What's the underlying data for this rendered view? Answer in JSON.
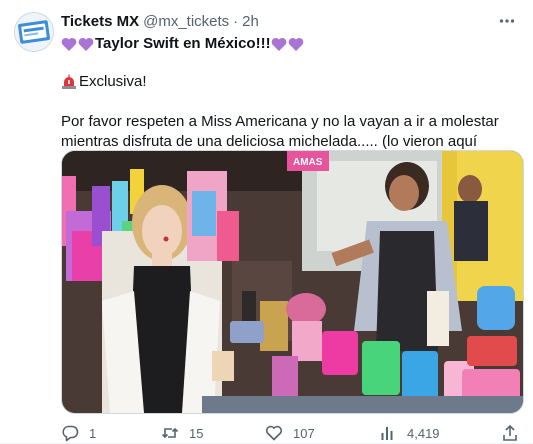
{
  "author": {
    "name": "Tickets MX",
    "handle": "@mx_tickets",
    "separator": "·",
    "time": "2h"
  },
  "tweet": {
    "title": "Taylor Swift en México!!!",
    "exclusive_label": "Exclusiva!",
    "body": "Por favor respeten a Miss Americana y no la vayan a ir a molestar mientras disfruta de una deliciosa michelada..... (lo vieron aquí primero)"
  },
  "media": {
    "sign_text": "AMAS"
  },
  "actions": {
    "replies": "1",
    "retweets": "15",
    "likes": "107",
    "views": "4,419"
  },
  "icons": {
    "heart_color": "#a875d6",
    "siren_color": "#e0333a",
    "icon_color": "#536471"
  }
}
